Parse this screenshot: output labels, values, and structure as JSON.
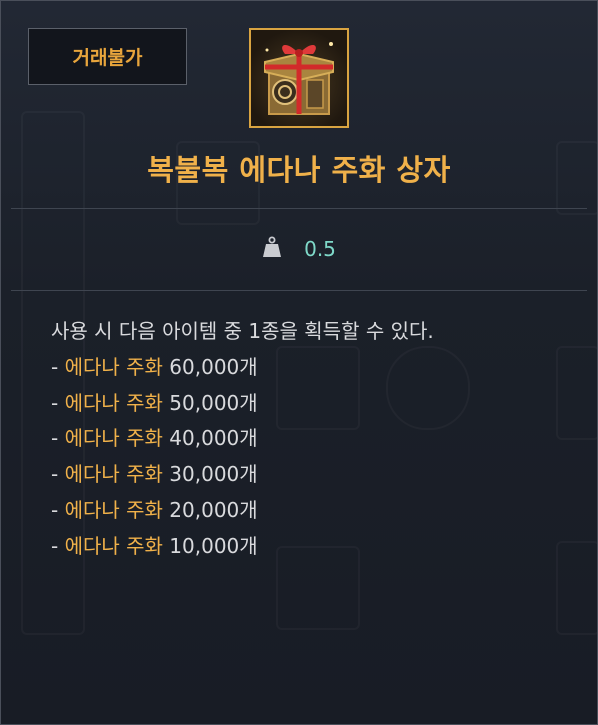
{
  "badge": {
    "label": "거래불가"
  },
  "item": {
    "name": "복불복 에다나 주화 상자"
  },
  "weight": {
    "value": "0.5"
  },
  "description": {
    "intro": "사용 시 다음 아이템 중 1종을 획득할 수 있다.",
    "rewards": [
      {
        "prefix": "- ",
        "name": "에다나 주화",
        "amount": " 60,000개"
      },
      {
        "prefix": "- ",
        "name": "에다나 주화",
        "amount": " 50,000개"
      },
      {
        "prefix": "- ",
        "name": "에다나 주화",
        "amount": " 40,000개"
      },
      {
        "prefix": "- ",
        "name": "에다나 주화",
        "amount": " 30,000개"
      },
      {
        "prefix": "- ",
        "name": "에다나 주화",
        "amount": " 20,000개"
      },
      {
        "prefix": "- ",
        "name": "에다나 주화",
        "amount": " 10,000개"
      }
    ]
  },
  "colors": {
    "accent": "#f0b14a",
    "weight": "#7fd9c9",
    "text": "#d9dadd"
  },
  "icons": {
    "item": "gift-box-icon",
    "weight": "weight-icon"
  }
}
